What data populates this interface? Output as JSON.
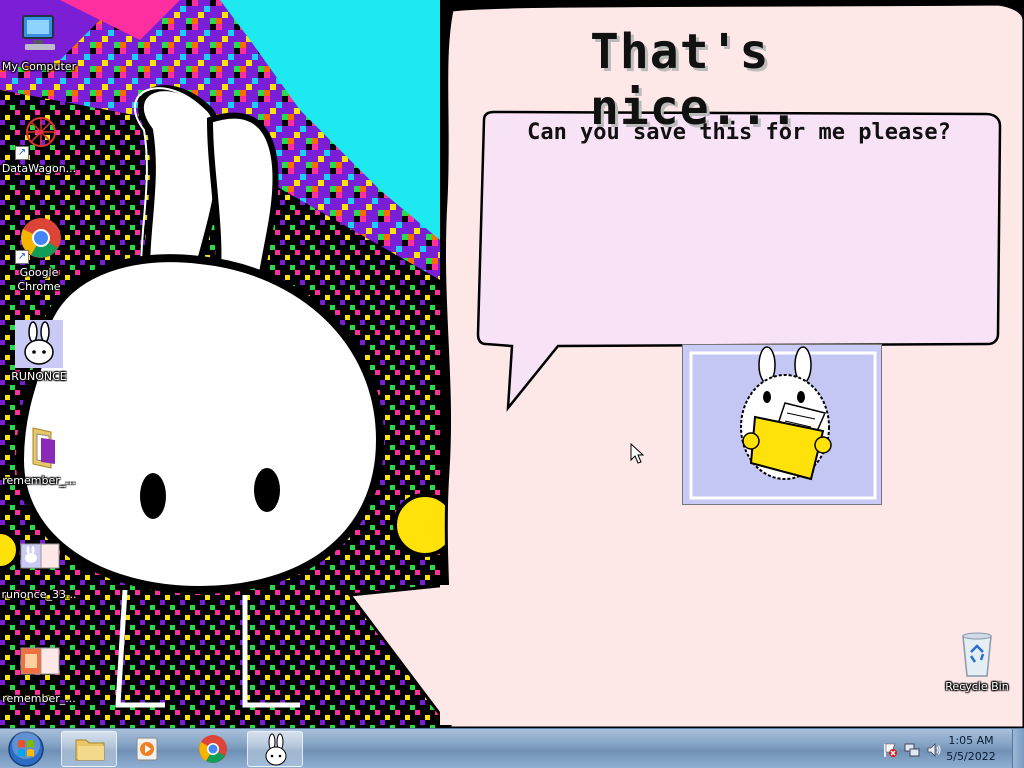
{
  "colors": {
    "panel_bg": "#fde7e7",
    "dialog_bg": "#f8e2f5",
    "card_bg": "#c9cbf6",
    "bunny_yellow": "#ffe20a",
    "wallpaper_cyan": "#1ee8f0",
    "wallpaper_purple": "#8a2be2"
  },
  "desktop": {
    "icons": [
      {
        "label": "My Computer",
        "icon": "computer-icon"
      },
      {
        "label": "DataWagon...",
        "icon": "network-web-icon"
      },
      {
        "label": "Google Chrome",
        "icon": "chrome-icon"
      },
      {
        "label": "RUNONCE",
        "icon": "bunny-app-icon"
      },
      {
        "label": "remember_...",
        "icon": "folder-icon"
      },
      {
        "label": "runonce_33...",
        "icon": "image-file-icon"
      },
      {
        "label": "remember_...",
        "icon": "image-file-icon"
      }
    ],
    "recycle_bin": {
      "label": "Recycle Bin",
      "icon": "recycle-bin-icon"
    }
  },
  "dialog": {
    "title": "That's nice...",
    "message": "Can you save this for me please?"
  },
  "taskbar": {
    "start_icon": "windows-start-icon",
    "pinned": [
      {
        "name": "file-explorer",
        "icon": "folder-icon",
        "active": true
      },
      {
        "name": "media-player",
        "icon": "media-player-icon",
        "active": false
      },
      {
        "name": "chrome",
        "icon": "chrome-icon",
        "active": false
      },
      {
        "name": "runonce",
        "icon": "bunny-app-icon",
        "active": true
      }
    ],
    "tray": {
      "icons": [
        "action-center-flag-icon",
        "network-icon",
        "volume-icon"
      ],
      "time": "1:05 AM",
      "date": "5/5/2022"
    }
  }
}
